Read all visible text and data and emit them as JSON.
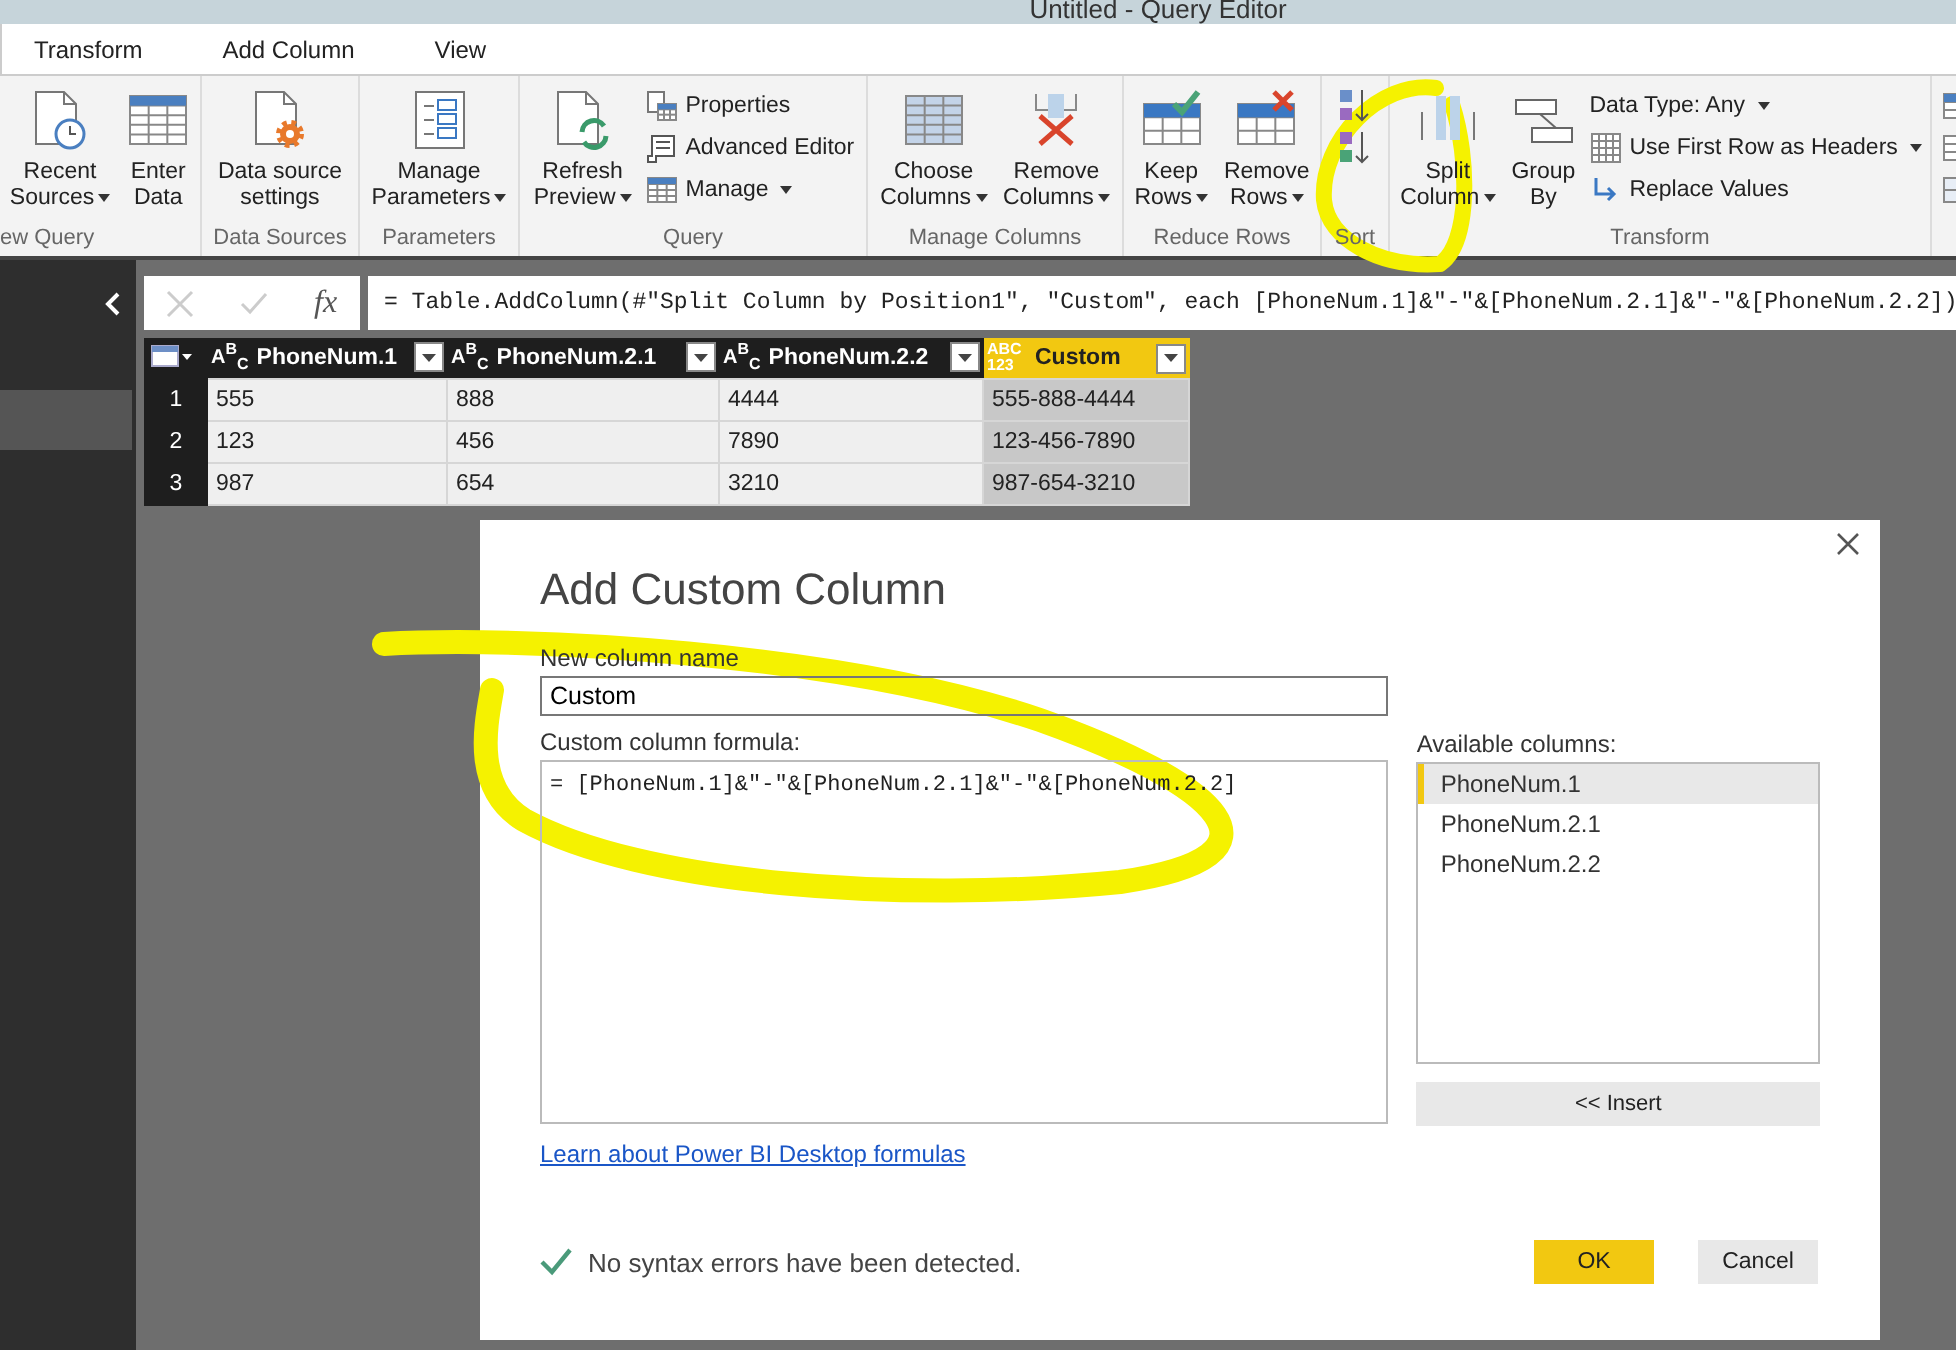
{
  "window": {
    "title": "Untitled - Query Editor"
  },
  "tabs": [
    {
      "label": "Transform",
      "selected": false
    },
    {
      "label": "Add Column",
      "selected": false
    },
    {
      "label": "View",
      "selected": false
    }
  ],
  "ribbon": {
    "groups": [
      {
        "label": "ew Query",
        "items": [
          {
            "kind": "large",
            "label": "Recent\nSources",
            "dropdown": true
          },
          {
            "kind": "large",
            "label": "Enter\nData",
            "dropdown": false
          }
        ]
      },
      {
        "label": "Data Sources",
        "items": [
          {
            "kind": "large",
            "label": "Data source\nsettings",
            "dropdown": false
          }
        ]
      },
      {
        "label": "Parameters",
        "items": [
          {
            "kind": "large",
            "label": "Manage\nParameters",
            "dropdown": true
          }
        ]
      },
      {
        "label": "Query",
        "items": [
          {
            "kind": "large",
            "label": "Refresh\nPreview",
            "dropdown": true
          },
          {
            "kind": "stack",
            "items": [
              {
                "label": "Properties",
                "dropdown": false
              },
              {
                "label": "Advanced Editor",
                "dropdown": false
              },
              {
                "label": "Manage",
                "dropdown": true
              }
            ]
          }
        ]
      },
      {
        "label": "Manage Columns",
        "items": [
          {
            "kind": "large",
            "label": "Choose\nColumns",
            "dropdown": true
          },
          {
            "kind": "large",
            "label": "Remove\nColumns",
            "dropdown": true
          }
        ]
      },
      {
        "label": "Reduce Rows",
        "items": [
          {
            "kind": "large",
            "label": "Keep\nRows",
            "dropdown": true
          },
          {
            "kind": "large",
            "label": "Remove\nRows",
            "dropdown": true
          }
        ]
      },
      {
        "label": "Sort",
        "items": [
          {
            "kind": "stack",
            "items": [
              {
                "dropdown": false
              },
              {
                "dropdown": false
              }
            ]
          }
        ]
      },
      {
        "label": "Transform",
        "items": [
          {
            "kind": "large",
            "label": "Split\nColumn",
            "dropdown": true
          },
          {
            "kind": "large",
            "label": "Group\nBy",
            "dropdown": false
          },
          {
            "kind": "stack",
            "items": [
              {
                "label": "Data Type: Any",
                "dropdown": true
              },
              {
                "label": "Use First Row as Headers",
                "dropdown": true
              },
              {
                "label": "Replace Values",
                "dropdown": false
              }
            ]
          }
        ]
      },
      {
        "items": [
          {
            "kind": "icon-stack"
          }
        ]
      }
    ]
  },
  "formula_bar": {
    "fx": "fx",
    "formula": "= Table.AddColumn(#\"Split Column by Position1\", \"Custom\", each [PhoneNum.1]&\"-\"&[PhoneNum.2.1]&\"-\"&[PhoneNum.2.2])"
  },
  "table": {
    "columns": [
      {
        "name": "PhoneNum.1",
        "type": "A$^{B}$$_{C}$",
        "selected": false
      },
      {
        "name": "PhoneNum.2.1",
        "type": "A$^{B}$$_{C}$",
        "selected": false
      },
      {
        "name": "PhoneNum.2.2",
        "type": "A$^{B}$$_{C}$",
        "selected": false
      },
      {
        "name": "Custom",
        "type": "ABC 123",
        "selected": true
      }
    ],
    "rows": [
      {
        "number": "1",
        "cells": [
          "555",
          "888",
          "4444",
          "555-888-4444"
        ]
      },
      {
        "number": "2",
        "cells": [
          "123",
          "456",
          "7890",
          "123-456-7890"
        ]
      },
      {
        "number": "3",
        "cells": [
          "987",
          "654",
          "3210",
          "987-654-3210"
        ]
      }
    ]
  },
  "dialog": {
    "title": "Add Custom Column",
    "name_label": "New column name",
    "name_value": "Custom",
    "formula_label": "Custom column formula:",
    "formula": "= [PhoneNum.1]&\"-\"&[PhoneNum.2.1]&\"-\"&[PhoneNum.2.2]",
    "columns_label": "Available columns:",
    "available_columns": [
      {
        "label": "PhoneNum.1",
        "selected": true
      },
      {
        "label": "PhoneNum.2.1",
        "selected": false
      },
      {
        "label": "PhoneNum.2.2",
        "selected": false
      }
    ],
    "insert_button": "<< Insert",
    "link": "Learn about Power BI Desktop formulas",
    "status": "No syntax errors have been detected.",
    "buttons": [
      {
        "label": "OK",
        "kind": "primary"
      },
      {
        "label": "Cancel",
        "kind": "secondary"
      }
    ]
  }
}
